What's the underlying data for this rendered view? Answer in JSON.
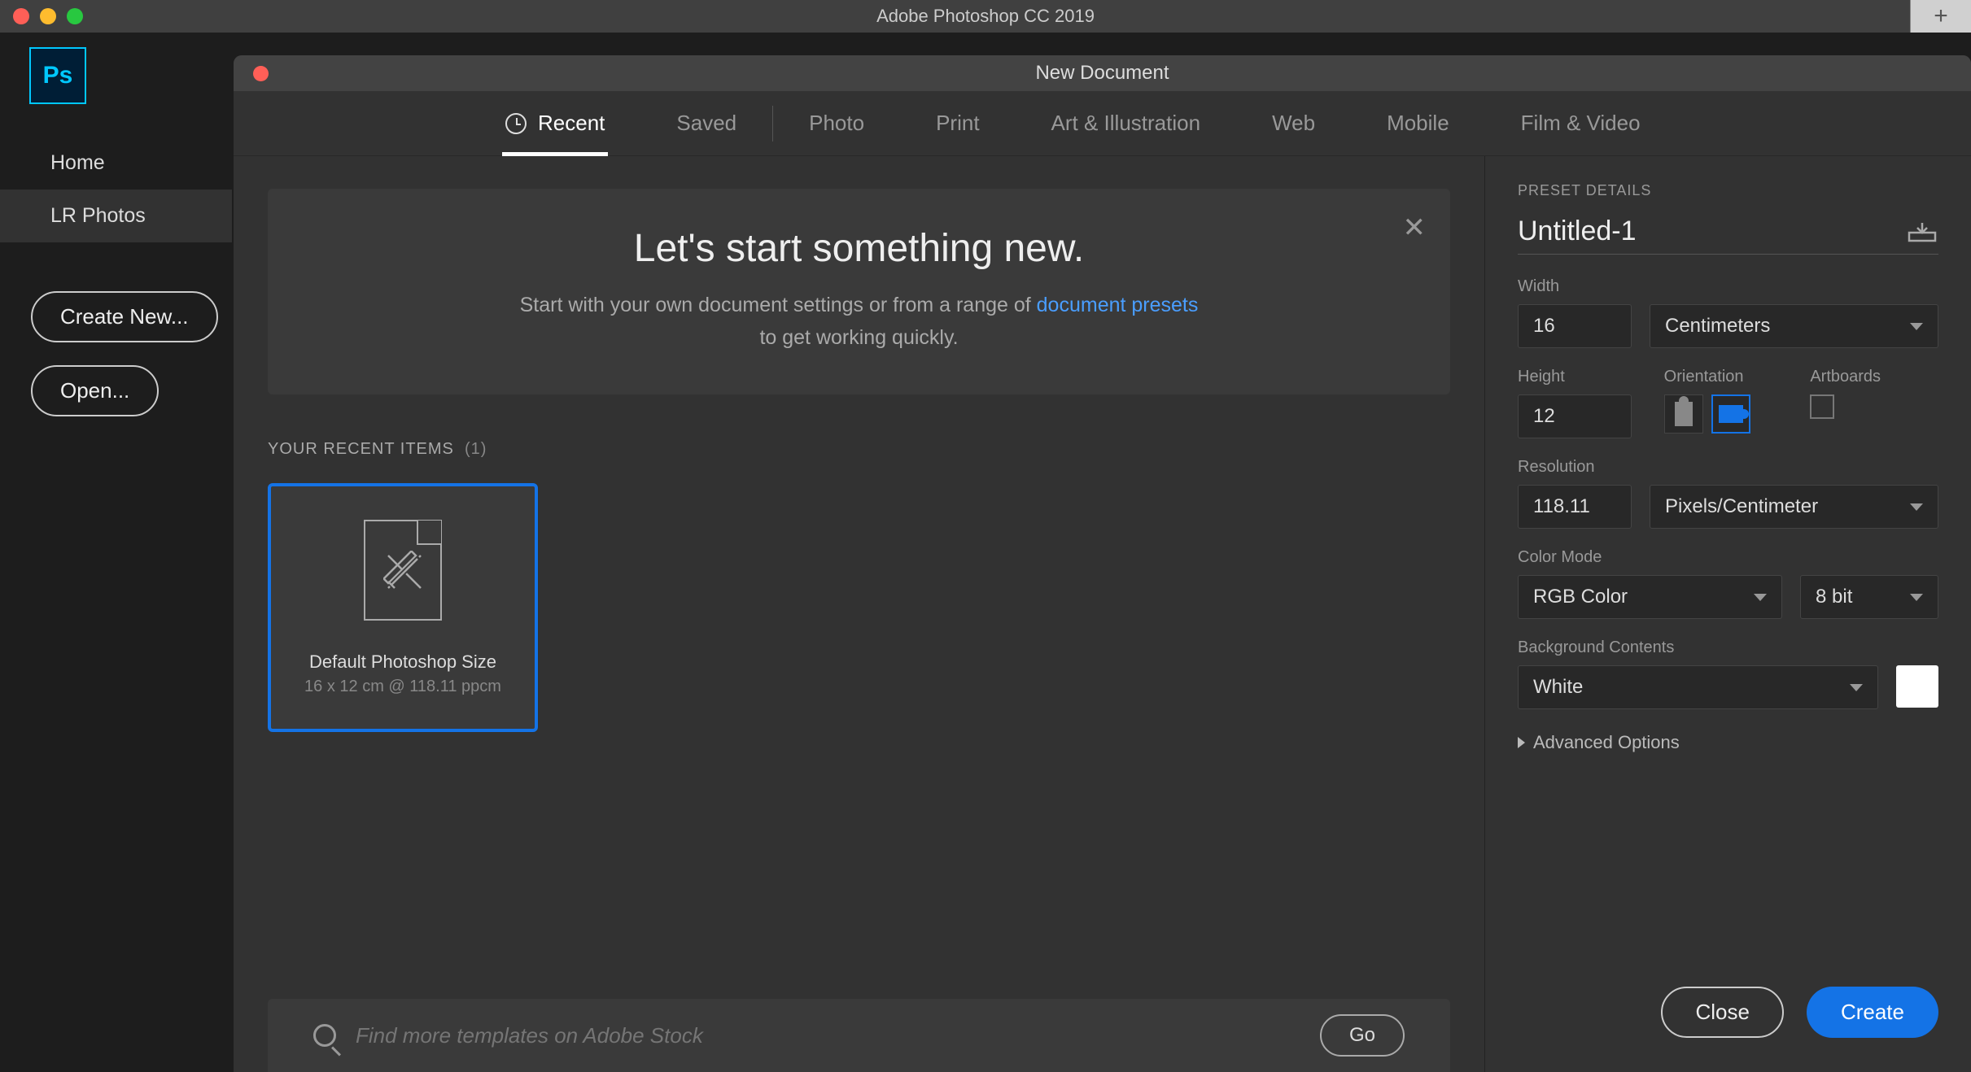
{
  "app": {
    "title": "Adobe Photoshop CC 2019",
    "logo_text": "Ps"
  },
  "sidebar": {
    "items": [
      {
        "label": "Home",
        "active": false
      },
      {
        "label": "LR Photos",
        "active": true
      }
    ],
    "create_label": "Create New...",
    "open_label": "Open..."
  },
  "dialog": {
    "title": "New Document",
    "tabs": [
      "Recent",
      "Saved",
      "Photo",
      "Print",
      "Art & Illustration",
      "Web",
      "Mobile",
      "Film & Video"
    ],
    "active_tab": "Recent",
    "hero": {
      "heading": "Let's start something new.",
      "sub_pre": "Start with your own document settings or from a range of ",
      "sub_link": "document presets",
      "sub_post": " to get working quickly."
    },
    "recent_label": "YOUR RECENT ITEMS",
    "recent_count": "(1)",
    "presets": [
      {
        "name": "Default Photoshop Size",
        "meta": "16 x 12 cm @ 118.11 ppcm"
      }
    ],
    "stock": {
      "placeholder": "Find more templates on Adobe Stock",
      "go_label": "Go"
    }
  },
  "panel": {
    "heading": "PRESET DETAILS",
    "name_value": "Untitled-1",
    "width_label": "Width",
    "width_value": "16",
    "width_unit": "Centimeters",
    "height_label": "Height",
    "height_value": "12",
    "orientation_label": "Orientation",
    "artboards_label": "Artboards",
    "resolution_label": "Resolution",
    "resolution_value": "118.11",
    "resolution_unit": "Pixels/Centimeter",
    "colormode_label": "Color Mode",
    "colormode_value": "RGB Color",
    "colordepth_value": "8 bit",
    "bg_label": "Background Contents",
    "bg_value": "White",
    "advanced_label": "Advanced Options",
    "close_label": "Close",
    "create_label": "Create"
  }
}
